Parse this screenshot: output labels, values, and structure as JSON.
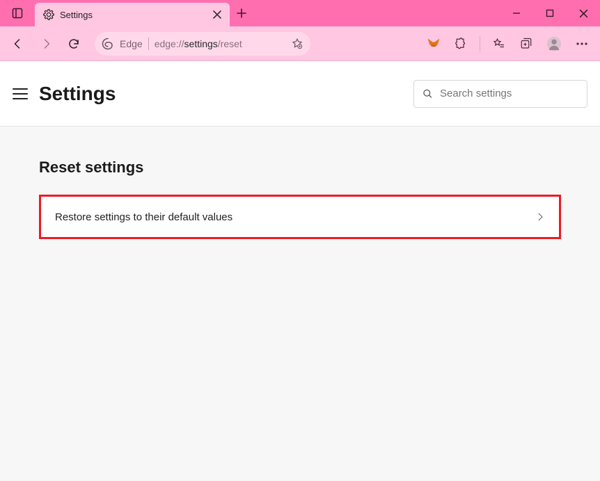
{
  "tab": {
    "title": "Settings"
  },
  "address": {
    "brand": "Edge",
    "url_prefix": "edge://",
    "url_strong": "settings",
    "url_suffix": "/reset"
  },
  "header": {
    "title": "Settings",
    "search_placeholder": "Search settings"
  },
  "section": {
    "title": "Reset settings",
    "option_label": "Restore settings to their default values"
  }
}
